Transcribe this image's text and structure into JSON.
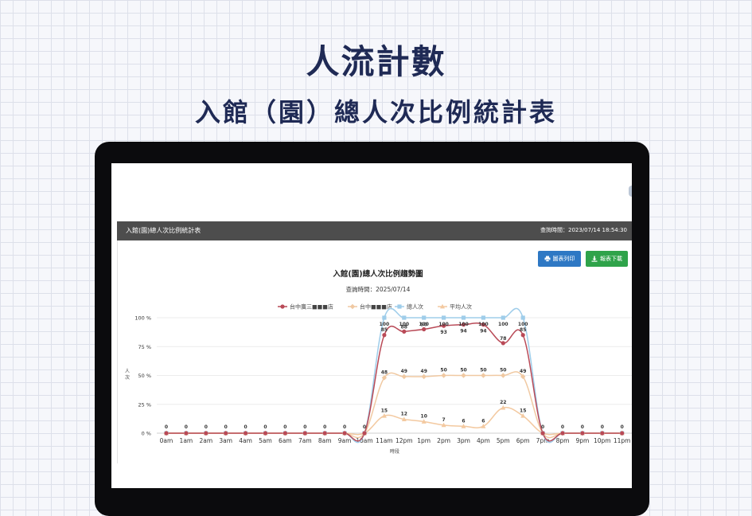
{
  "hero": {
    "title": "人流計數",
    "subtitle": "入館（園）總人次比例統計表"
  },
  "panel": {
    "title": "入館(園)總人次比例統計表",
    "timestamp": "查詢時間：2023/07/14 18:54:30",
    "print_button": "圖表列印",
    "download_button": "報表下載"
  },
  "colors": {
    "store1": "#b94a57",
    "store2": "#f0c9a2",
    "total": "#9fcdea",
    "average": "#f3c9a0",
    "print_button": "#2e78c4",
    "download_button": "#2fa34a"
  },
  "chart_data": {
    "type": "line",
    "title": "入館(園)總人次比例趨勢圖",
    "subtitle": "查詢時間：2025/07/14",
    "xlabel": "時段",
    "ylabel": "人次",
    "ylim": [
      0,
      100
    ],
    "y_ticks": [
      "0 %",
      "25 %",
      "50 %",
      "75 %",
      "100 %"
    ],
    "legend_position": "top",
    "grid": true,
    "categories": [
      "0am",
      "1am",
      "2am",
      "3am",
      "4am",
      "5am",
      "6am",
      "7am",
      "8am",
      "9am",
      "10am",
      "11am",
      "12pm",
      "1pm",
      "2pm",
      "3pm",
      "4pm",
      "5pm",
      "6pm",
      "7pm",
      "8pm",
      "9pm",
      "10pm",
      "11pm"
    ],
    "series": [
      {
        "name": "台中廣三■■■店",
        "color": "#b94a57",
        "marker": "circle",
        "show_labels": true,
        "values": [
          0,
          0,
          0,
          0,
          0,
          0,
          0,
          0,
          0,
          0,
          0,
          85,
          88,
          90,
          93,
          94,
          94,
          78,
          85,
          0,
          0,
          0,
          0,
          0
        ]
      },
      {
        "name": "台中■■■店",
        "color": "#f0c9a2",
        "marker": "diamond",
        "show_labels": true,
        "values": [
          0,
          0,
          0,
          0,
          0,
          0,
          0,
          0,
          0,
          0,
          0,
          48,
          49,
          49,
          50,
          50,
          50,
          50,
          49,
          0,
          0,
          0,
          0,
          0
        ]
      },
      {
        "name": "總人次",
        "color": "#9fcdea",
        "marker": "square",
        "show_labels": true,
        "values": [
          0,
          0,
          0,
          0,
          0,
          0,
          0,
          0,
          0,
          0,
          0,
          100,
          100,
          100,
          100,
          100,
          100,
          100,
          100,
          0,
          0,
          0,
          0,
          0
        ]
      },
      {
        "name": "平均人次",
        "color": "#f3c9a0",
        "marker": "triangle",
        "show_labels": true,
        "values": [
          0,
          0,
          0,
          0,
          0,
          0,
          0,
          0,
          0,
          0,
          0,
          15,
          12,
          10,
          7,
          6,
          6,
          22,
          15,
          0,
          0,
          0,
          0,
          0
        ]
      }
    ]
  }
}
